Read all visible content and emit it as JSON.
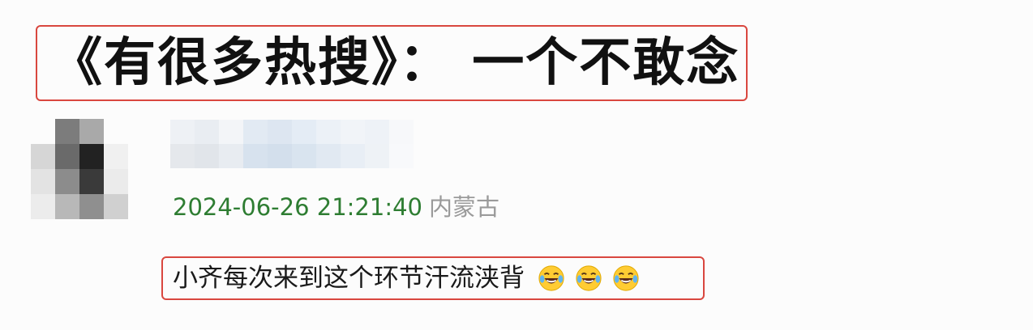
{
  "title": "《有很多热搜》： 一个不敢念",
  "comment": {
    "user": {
      "name_redacted": true,
      "avatar": "pixelated-avatar"
    },
    "timestamp": "2024-06-26 21:21:40",
    "location": "内蒙古",
    "text": "小齐每次来到这个环节汗流浃背",
    "emojis": [
      "tears-of-joy-emoji",
      "tears-of-joy-emoji",
      "tears-of-joy-emoji"
    ]
  },
  "colors": {
    "highlight_border": "#d9473f",
    "timestamp": "#2e7d32",
    "location": "#9a9a9a"
  }
}
